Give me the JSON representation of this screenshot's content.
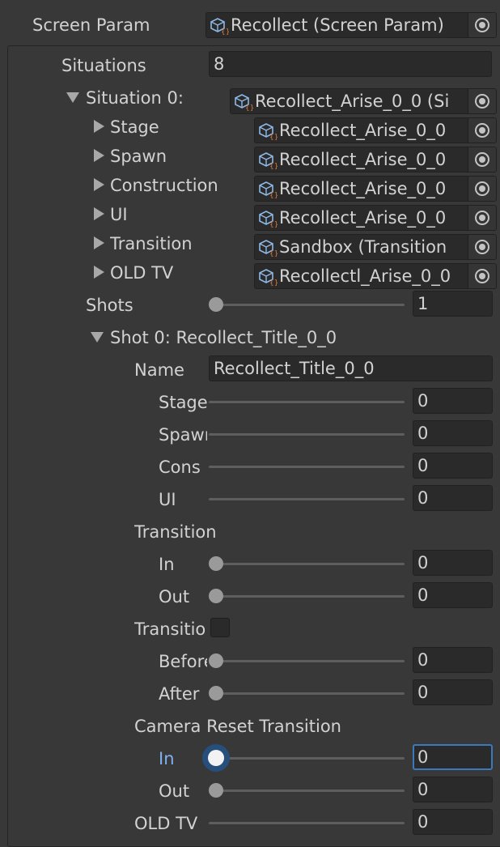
{
  "screen_param": {
    "label": "Screen Param",
    "value": "Recollect (Screen Param)",
    "icon": "scriptable-object-icon"
  },
  "situations": {
    "label": "Situations",
    "count": "8",
    "situation0": {
      "label": "Situation 0:",
      "value": "Recollect_Arise_0_0 (Si",
      "children": [
        {
          "label": "Stage",
          "value": "Recollect_Arise_0_0"
        },
        {
          "label": "Spawn",
          "value": "Recollect_Arise_0_0"
        },
        {
          "label": "Construction",
          "value": "Recollect_Arise_0_0"
        },
        {
          "label": "UI",
          "value": "Recollect_Arise_0_0"
        },
        {
          "label": "Transition",
          "value": "Sandbox (Transition"
        },
        {
          "label": "OLD TV",
          "value": "Recollectl_Arise_0_0"
        }
      ],
      "shots": {
        "label": "Shots",
        "value": "1",
        "slider_value": 0,
        "shot0": {
          "label": "Shot 0: Recollect_Title_0_0",
          "name_label": "Name",
          "name_value": "Recollect_Title_0_0",
          "stage": {
            "label": "Stage",
            "value": "0"
          },
          "spawn": {
            "label": "Spawn",
            "value": "0"
          },
          "cons": {
            "label": "Cons",
            "value": "0"
          },
          "ui": {
            "label": "UI",
            "value": "0"
          },
          "transition": {
            "label": "Transition",
            "in": {
              "label": "In",
              "value": "0"
            },
            "out": {
              "label": "Out",
              "value": "0"
            }
          },
          "transition_toggle": {
            "label": "Transition",
            "checked": false
          },
          "before": {
            "label": "Before",
            "value": "0"
          },
          "after": {
            "label": "After",
            "value": "0"
          },
          "camera_reset_transition": {
            "label": "Camera Reset Transition",
            "in": {
              "label": "In",
              "value": "0"
            },
            "out": {
              "label": "Out",
              "value": "0"
            }
          },
          "old_tv": {
            "label": "OLD TV",
            "value": "0"
          }
        }
      }
    }
  },
  "colors": {
    "background": "#383838",
    "field": "#2a2a2a",
    "focus": "#3a79bb",
    "active_label": "#7fb1ee"
  }
}
